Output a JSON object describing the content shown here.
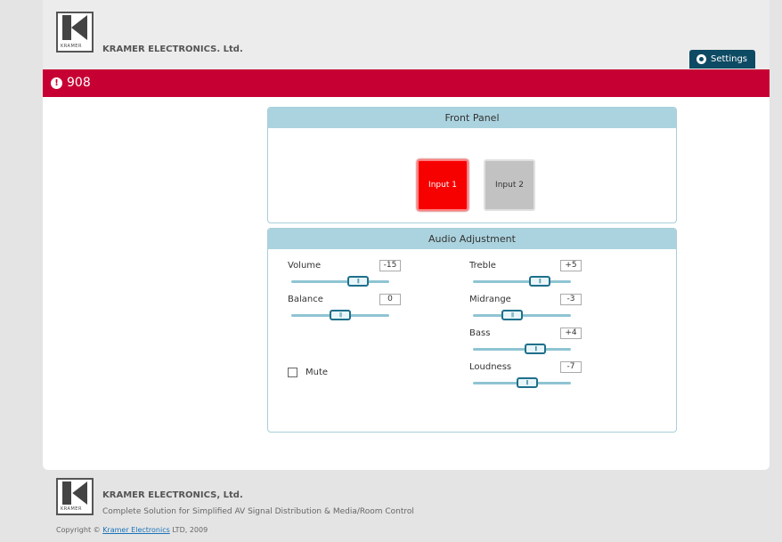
{
  "header": {
    "logo_text": "KRAMER",
    "company_name": "KRAMER ELECTRONICS. Ltd.",
    "settings_label": "Settings"
  },
  "device": {
    "name": "908"
  },
  "front_panel": {
    "title": "Front Panel",
    "inputs": [
      {
        "label": "Input 1",
        "selected": true
      },
      {
        "label": "Input 2",
        "selected": false
      }
    ]
  },
  "audio": {
    "title": "Audio Adjustment",
    "left_controls": [
      {
        "label": "Volume",
        "value": "-15",
        "level": 0.68
      },
      {
        "label": "Balance",
        "value": "0",
        "level": 0.5
      }
    ],
    "right_controls": [
      {
        "label": "Treble",
        "value": "+5",
        "level": 0.68
      },
      {
        "label": "Midrange",
        "value": "-3",
        "level": 0.4
      },
      {
        "label": "Bass",
        "value": "+4",
        "level": 0.64
      },
      {
        "label": "Loudness",
        "value": "-7",
        "level": 0.55
      }
    ],
    "mute_label": "Mute",
    "mute_checked": false
  },
  "footer": {
    "logo_text": "KRAMER",
    "company_name": "KRAMER ELECTRONICS, Ltd.",
    "tagline": "Complete Solution for Simplified AV Signal Distribution & Media/Room Control",
    "copyright_prefix": "Copyright ©",
    "copyright_link": "Kramer Electronics",
    "copyright_suffix": "LTD, 2009"
  }
}
